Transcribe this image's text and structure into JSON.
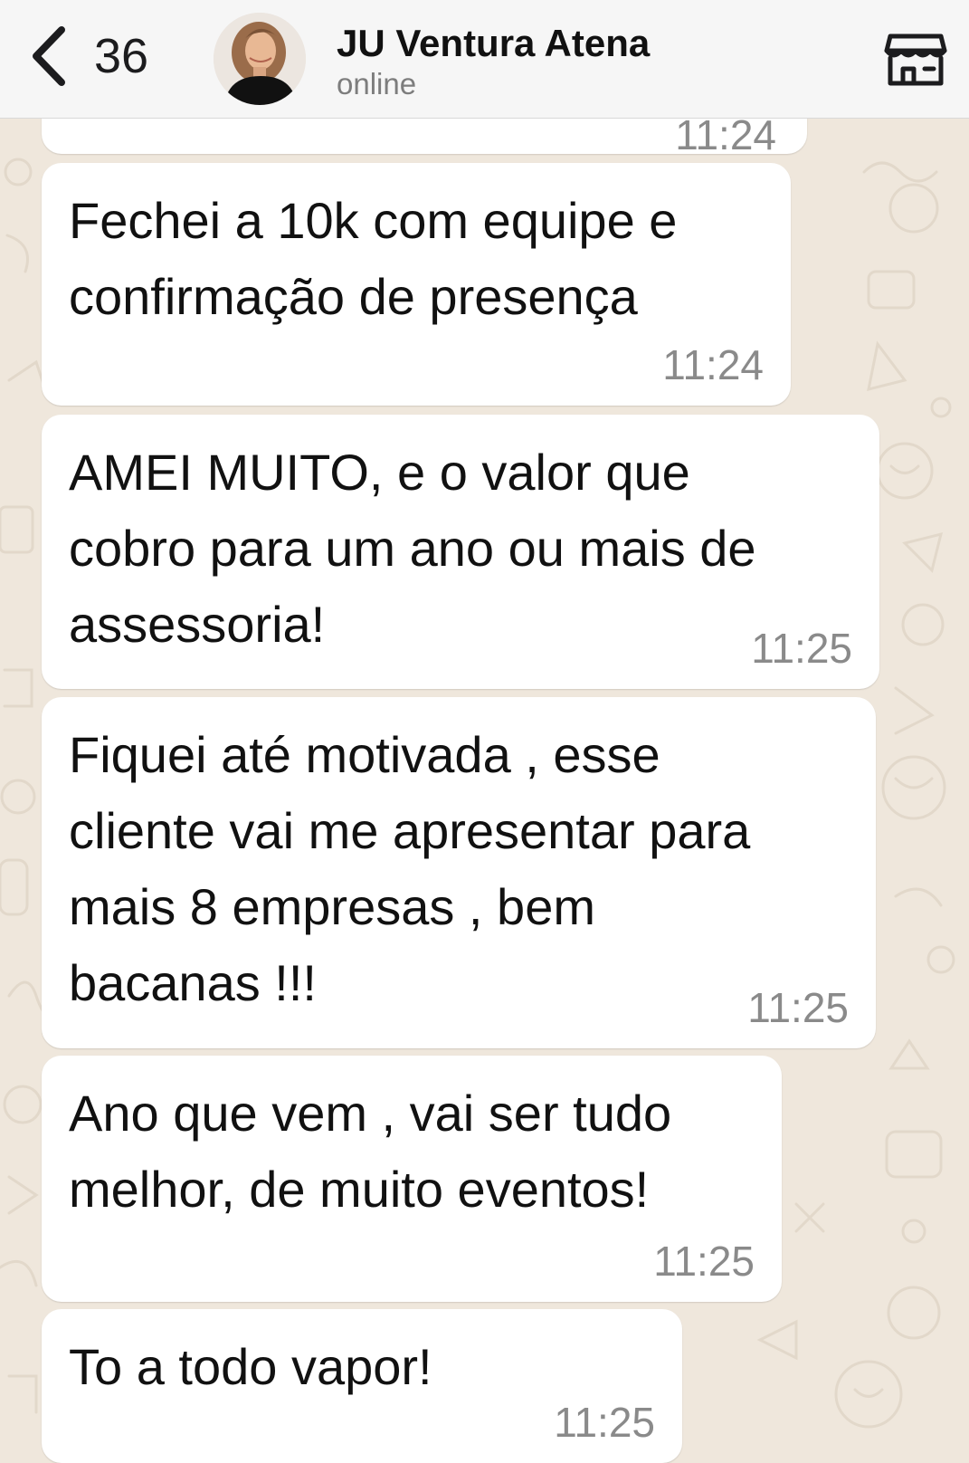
{
  "header": {
    "back_count": "36",
    "contact_name": "JU Ventura Atena",
    "contact_status": "online"
  },
  "icons": {
    "back": "chevron-left-icon",
    "avatar": "contact-avatar",
    "store": "store-icon"
  },
  "colors": {
    "chat_background": "#efe7dc",
    "bubble": "#ffffff",
    "header": "#f6f6f6",
    "timestamp": "#8a8a8a"
  },
  "messages": [
    {
      "text": "",
      "time": "11:24"
    },
    {
      "text": "Fechei a 10k com equipe e\nconfirmação de presença",
      "time": "11:24"
    },
    {
      "text": "AMEI MUITO, e o valor que\ncobro para um ano ou mais de\nassessoria!",
      "time": "11:25"
    },
    {
      "text": "Fiquei até motivada , esse\ncliente vai me apresentar para\nmais 8 empresas , bem\nbacanas !!!",
      "time": "11:25"
    },
    {
      "text": "Ano que vem , vai ser tudo\nmelhor, de muito eventos!",
      "time": "11:25"
    },
    {
      "text": "To a todo vapor!",
      "time": "11:25"
    }
  ]
}
